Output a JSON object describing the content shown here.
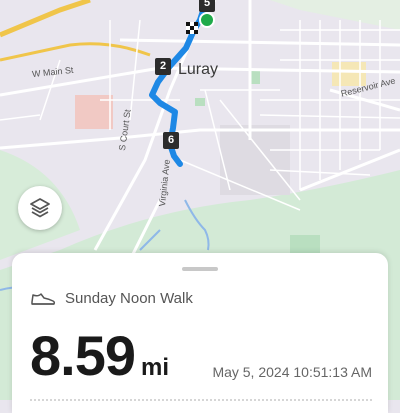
{
  "map": {
    "town_label": "Luray",
    "street_labels": {
      "w_main": "W Main St",
      "reservoir": "Reservoir Ave",
      "court": "S Court St",
      "virginia": "Virginia Ave"
    },
    "markers": [
      "5",
      "2",
      "6"
    ],
    "colors": {
      "route": "#1e88e5",
      "start_dot": "#1faa4a",
      "park": "#cfe8d6"
    }
  },
  "layers_button": {
    "icon": "layers-icon"
  },
  "activity": {
    "icon": "shoe-icon",
    "title": "Sunday Noon Walk",
    "distance_value": "8.59",
    "distance_unit": "mi",
    "timestamp": "May 5, 2024 10:51:13 AM"
  }
}
